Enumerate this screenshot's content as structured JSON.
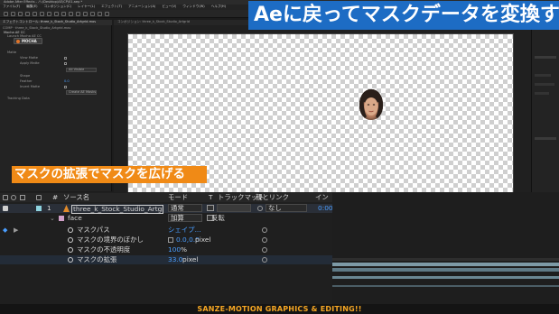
{
  "window": {
    "title": "Adobe After Effects - ハ:\\Desktop\\AE\\CP\\01.aep *"
  },
  "menubar": {
    "items": [
      "ファイル(F)",
      "編集(E)",
      "コンポジション(C)",
      "レイヤー(L)",
      "エフェクト(T)",
      "アニメーション(A)",
      "ビュー(V)",
      "ウィンドウ(W)",
      "ヘルプ(H)"
    ]
  },
  "overlays": {
    "big_title": "Aeに戻ってマスクデータを変換する",
    "caption": "マスクの拡張でマスクを広げる",
    "footer": "SANZE-MOTION GRAPHICS & EDITING!!"
  },
  "effects_panel": {
    "tab_label": "エフェクトコントロール: three_k_Stock_Studio_Artgrid.mov",
    "comp_line": "COMP · three_k_Stock_Studio_Artgrid.mov",
    "mocha_label": "MOCHA",
    "rows": [
      "Mocha AE CC",
      "Launch Mocha AE CC",
      "Matte",
      "View Matte",
      "Apply Matte",
      "Shape",
      "Feather",
      "Invert Matte",
      "Tracking Data"
    ],
    "button_label": "Create AE Masks",
    "shape_value": "All Visible",
    "feather_value": "0.0"
  },
  "composition": {
    "tab_label": "コンポジション: three_k_Stock_Studio_Artgrid"
  },
  "timeline": {
    "headers": {
      "source_name": "ソース名",
      "mode": "モード",
      "t": "T",
      "track_matte": "トラックマット",
      "parent": "親とリンク",
      "in": "イン"
    },
    "layer": {
      "number": "1",
      "name": "three_k_Stock_Studio_Artgrid.mov",
      "mode": "通常",
      "parent": "なし",
      "in_value": "0:00"
    },
    "mask": {
      "name": "face",
      "mode": "加算",
      "invert_label": "反転"
    },
    "properties": [
      {
        "name": "マスクパス",
        "value": "シェイプ...",
        "unit": ""
      },
      {
        "name": "マスクの境界のぼかし",
        "value": "0.0,0.0",
        "unit": "pixel"
      },
      {
        "name": "マスクの不透明度",
        "value": "100",
        "unit": "%"
      },
      {
        "name": "マスクの拡張",
        "value": "33.0",
        "unit": "pixel"
      }
    ]
  },
  "colors": {
    "title_bg": "#1d6cc4",
    "caption_bg": "#f08a16",
    "footer_text": "#f5a623",
    "value_blue": "#4a9eff"
  }
}
